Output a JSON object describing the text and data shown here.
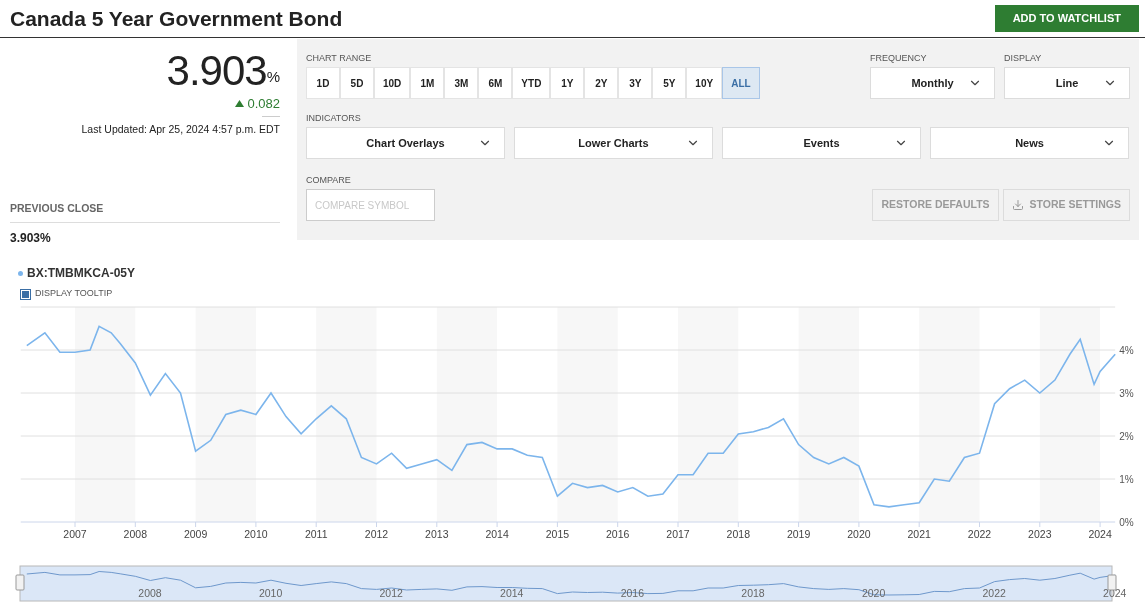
{
  "title": "Canada 5 Year Government Bond",
  "watchlist_button": "ADD TO WATCHLIST",
  "quote": {
    "price": "3.903",
    "unit": "%",
    "change": "0.082",
    "positive": true,
    "last_updated": "Last Updated: Apr 25, 2024 4:57 p.m. EDT"
  },
  "previous_close": {
    "label": "PREVIOUS CLOSE",
    "value": "3.903%"
  },
  "controls": {
    "chart_range": {
      "label": "CHART RANGE",
      "options": [
        {
          "label": "1D",
          "selected": false
        },
        {
          "label": "5D",
          "selected": false
        },
        {
          "label": "10D",
          "selected": false
        },
        {
          "label": "1M",
          "selected": false
        },
        {
          "label": "3M",
          "selected": false
        },
        {
          "label": "6M",
          "selected": false
        },
        {
          "label": "YTD",
          "selected": false
        },
        {
          "label": "1Y",
          "selected": false
        },
        {
          "label": "2Y",
          "selected": false
        },
        {
          "label": "3Y",
          "selected": false
        },
        {
          "label": "5Y",
          "selected": false
        },
        {
          "label": "10Y",
          "selected": false
        },
        {
          "label": "ALL",
          "selected": true
        }
      ]
    },
    "frequency": {
      "label": "FREQUENCY",
      "value": "Monthly"
    },
    "display": {
      "label": "DISPLAY",
      "value": "Line"
    },
    "indicators": {
      "label": "INDICATORS",
      "dropdowns": [
        "Chart Overlays",
        "Lower Charts",
        "Events",
        "News"
      ]
    },
    "compare": {
      "label": "COMPARE",
      "placeholder": "COMPARE SYMBOL"
    },
    "buttons": [
      {
        "label": "RESTORE DEFAULTS",
        "kind": "plain"
      },
      {
        "label": "STORE SETTINGS",
        "kind": "download"
      }
    ]
  },
  "tooltip_toggle": {
    "label": "DISPLAY TOOLTIP",
    "checked": true
  },
  "chart": {
    "chart_data": {
      "type": "line",
      "x": [
        2006.2,
        2006.5,
        2006.75,
        2007,
        2007.25,
        2007.4,
        2007.6,
        2007.75,
        2008,
        2008.25,
        2008.5,
        2008.75,
        2009,
        2009.25,
        2009.5,
        2009.75,
        2010,
        2010.25,
        2010.5,
        2010.75,
        2011,
        2011.25,
        2011.5,
        2011.75,
        2012,
        2012.25,
        2012.5,
        2012.75,
        2013,
        2013.25,
        2013.5,
        2013.75,
        2014,
        2014.25,
        2014.5,
        2014.75,
        2015,
        2015.25,
        2015.5,
        2015.75,
        2016,
        2016.25,
        2016.5,
        2016.75,
        2017,
        2017.25,
        2017.5,
        2017.75,
        2018,
        2018.25,
        2018.5,
        2018.75,
        2019,
        2019.25,
        2019.5,
        2019.75,
        2020,
        2020.25,
        2020.5,
        2020.75,
        2021,
        2021.25,
        2021.5,
        2021.75,
        2022,
        2022.25,
        2022.5,
        2022.75,
        2023,
        2023.25,
        2023.5,
        2023.67,
        2023.9,
        2024,
        2024.25
      ],
      "series": [
        {
          "name": "BX:TMBMKCA-05Y",
          "color": "#7cb5ec",
          "values": [
            4.1,
            4.4,
            3.95,
            3.95,
            4.0,
            4.55,
            4.4,
            4.15,
            3.7,
            2.95,
            3.45,
            3.0,
            1.65,
            1.9,
            2.5,
            2.6,
            2.5,
            3.0,
            2.45,
            2.05,
            2.4,
            2.7,
            2.4,
            1.5,
            1.35,
            1.6,
            1.25,
            1.35,
            1.45,
            1.2,
            1.8,
            1.85,
            1.7,
            1.7,
            1.55,
            1.5,
            0.6,
            0.9,
            0.8,
            0.85,
            0.7,
            0.8,
            0.6,
            0.65,
            1.1,
            1.1,
            1.6,
            1.6,
            2.05,
            2.1,
            2.2,
            2.4,
            1.8,
            1.5,
            1.35,
            1.5,
            1.3,
            0.4,
            0.35,
            0.4,
            0.45,
            1.0,
            0.95,
            1.5,
            1.6,
            2.75,
            3.1,
            3.3,
            3.0,
            3.3,
            3.9,
            4.25,
            3.2,
            3.5,
            3.9
          ]
        }
      ],
      "xlim": [
        2006.1,
        2024.25
      ],
      "ylim": [
        0,
        5
      ],
      "grid": true,
      "yticks": [
        {
          "value": 0,
          "label": "0%"
        },
        {
          "value": 1,
          "label": "1%"
        },
        {
          "value": 2,
          "label": "2%"
        },
        {
          "value": 3,
          "label": "3%"
        },
        {
          "value": 4,
          "label": "4%"
        }
      ],
      "xticks": [
        2007,
        2008,
        2009,
        2010,
        2011,
        2012,
        2013,
        2014,
        2015,
        2016,
        2017,
        2018,
        2019,
        2020,
        2021,
        2022,
        2023,
        2024
      ]
    }
  },
  "navigator": {
    "labels": [
      "2008",
      "2010",
      "2012",
      "2014",
      "2016",
      "2018",
      "2020",
      "2022",
      "2024"
    ]
  }
}
